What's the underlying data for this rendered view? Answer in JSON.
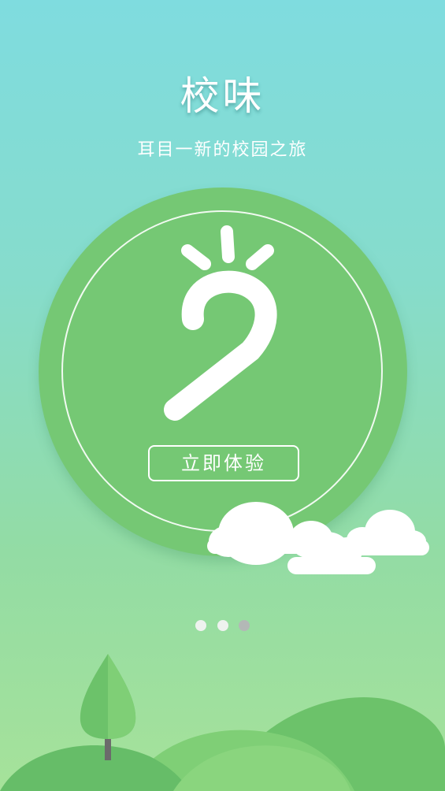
{
  "app": {
    "title": "校味",
    "subtitle": "耳目一新的校园之旅"
  },
  "hero": {
    "logo_icon": "bulb-hook-logo-icon",
    "cta_label": "立即体验"
  },
  "pager": {
    "total": 3,
    "active_index": 2
  },
  "colors": {
    "circle": "#75c874",
    "dot_inactive": "#eef2ef",
    "dot_active": "#b3b8b6",
    "text": "#ffffff"
  }
}
